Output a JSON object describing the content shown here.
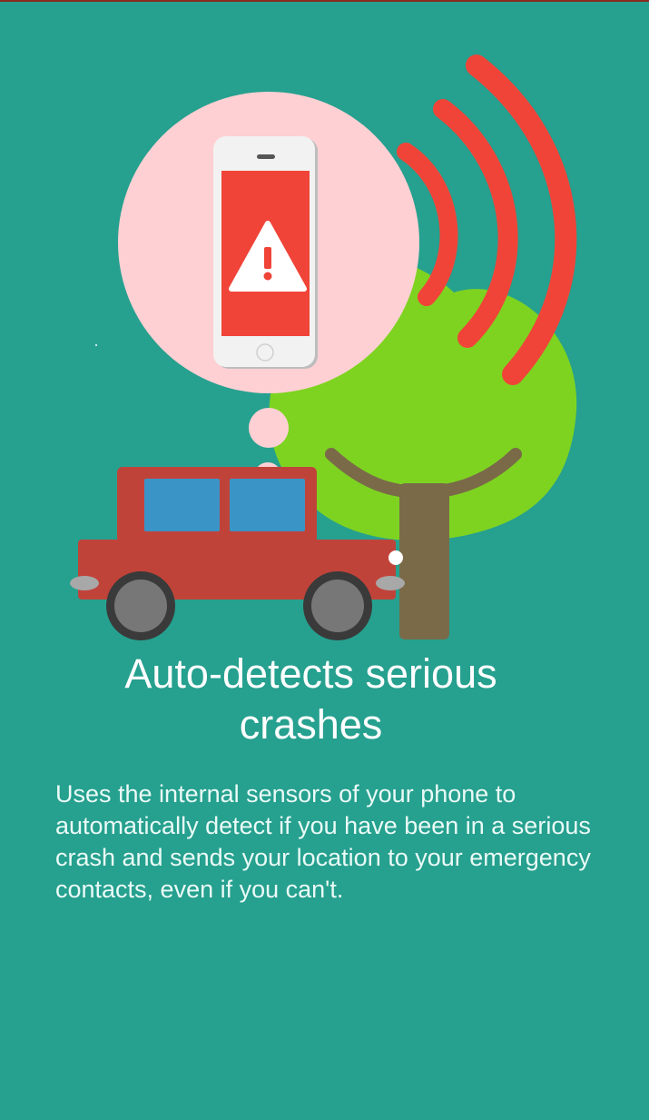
{
  "onboarding": {
    "title": "Auto-detects serious crashes",
    "description": "Uses the internal sensors of your phone to automatically detect if you have been in a serious crash and sends your location to your emergency contacts, even if you can't."
  },
  "colors": {
    "background": "#26a08f",
    "accent_red": "#f04438",
    "tree_green": "#7ed321",
    "car_red": "#c0433a",
    "bubble_pink": "#ffd0d3"
  },
  "illustration": {
    "icons": [
      "phone-icon",
      "warning-icon",
      "signal-waves-icon",
      "car-icon",
      "tree-icon",
      "thought-bubble-icon"
    ]
  }
}
